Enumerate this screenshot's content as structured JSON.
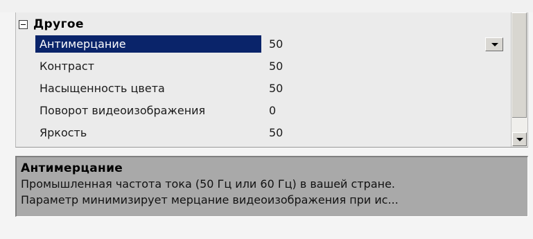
{
  "grid": {
    "category": {
      "label": "Другое",
      "expanded": true,
      "toggle_icon": "minus-box-icon"
    },
    "properties": [
      {
        "name": "Антимерцание",
        "value": "50",
        "selected": true,
        "has_dropdown": true
      },
      {
        "name": "Контраст",
        "value": "50",
        "selected": false
      },
      {
        "name": "Насыщенность цвета",
        "value": "50",
        "selected": false
      },
      {
        "name": "Поворот видеоизображения",
        "value": "0",
        "selected": false
      },
      {
        "name": "Яркость",
        "value": "50",
        "selected": false
      }
    ]
  },
  "description": {
    "title": "Антимерцание",
    "line1": "Промышленная частота тока (50 Гц или 60 Гц) в вашей стране.",
    "line2": "Параметр минимизирует мерцание видеоизображения при ис..."
  },
  "colors": {
    "selection_bg": "#0a246a",
    "selection_fg": "#ffffff",
    "description_bg": "#a9a9a9",
    "grid_bg": "#ebebeb"
  }
}
